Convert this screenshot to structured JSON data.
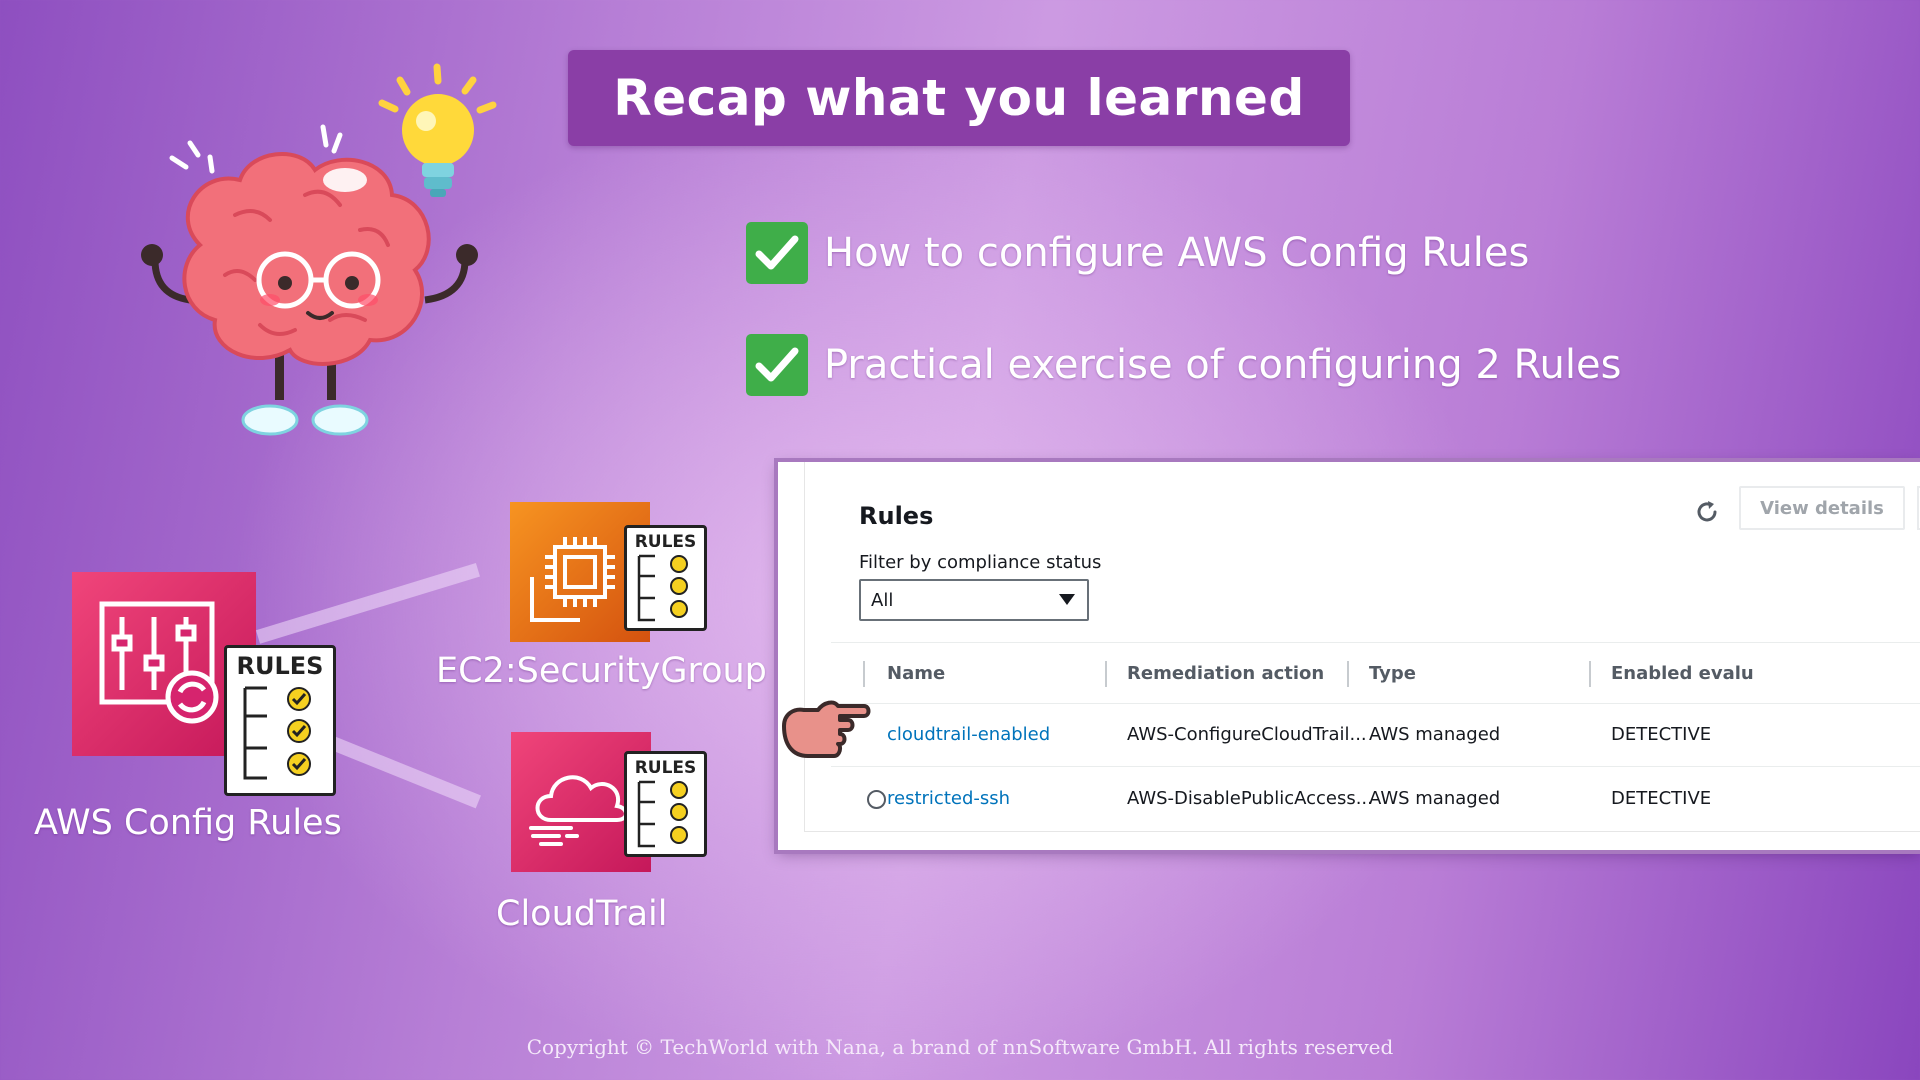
{
  "title": "Recap what you learned",
  "checklist": [
    {
      "text": "How to configure AWS Config Rules"
    },
    {
      "text": "Practical exercise of configuring 2 Rules"
    }
  ],
  "diagram": {
    "config_label": "AWS Config Rules",
    "ec2_label": "EC2:SecurityGroup",
    "cloudtrail_label": "CloudTrail",
    "rules_doc_label": "RULES"
  },
  "panel": {
    "title": "Rules",
    "filter_label": "Filter by compliance status",
    "filter_value": "All",
    "view_details_label": "View details",
    "columns": [
      "Name",
      "Remediation action",
      "Type",
      "Enabled evalu"
    ],
    "rows": [
      {
        "name": "cloudtrail-enabled",
        "remediation": "AWS-ConfigureCloudTrail...",
        "type": "AWS managed",
        "evaluation": "DETECTIVE"
      },
      {
        "name": "restricted-ssh",
        "remediation": "AWS-DisablePublicAccess...",
        "type": "AWS managed",
        "evaluation": "DETECTIVE"
      }
    ]
  },
  "colors": {
    "title_bar": "#8a3ea6",
    "check_green": "#3fae49",
    "config_pink": "#d6246e",
    "ec2_orange": "#e8701a",
    "link_blue": "#0073bb"
  },
  "icons": [
    "brain-mascot-icon",
    "lightbulb-icon",
    "checkmark-icon",
    "aws-config-icon",
    "ec2-chip-icon",
    "cloudtrail-cloud-icon",
    "rules-document-icon",
    "refresh-icon",
    "pointing-hand-icon",
    "caret-down-icon"
  ],
  "footer": {
    "copyright": "Copyright © TechWorld with Nana, a brand of nnSoftware GmbH. All rights reserved"
  }
}
